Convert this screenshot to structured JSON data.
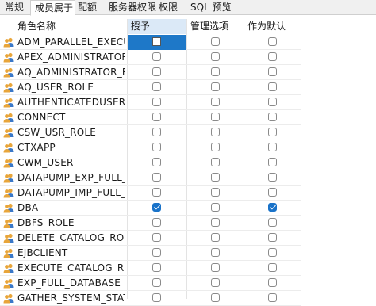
{
  "tabs": [
    {
      "label": "常规",
      "active": false
    },
    {
      "label": "成员属于",
      "active": true
    },
    {
      "label": "配额",
      "active": false
    },
    {
      "label": "服务器权限",
      "active": false
    },
    {
      "label": "权限",
      "active": false
    },
    {
      "label": "SQL 预览",
      "active": false
    }
  ],
  "columns": {
    "name": "角色名称",
    "grant": "授予",
    "admin": "管理选项",
    "default": "作为默认"
  },
  "rows": [
    {
      "name": "ADM_PARALLEL_EXECUTE",
      "grant": false,
      "admin": false,
      "default": false
    },
    {
      "name": "APEX_ADMINISTRATOR_ROLE",
      "grant": false,
      "admin": false,
      "default": false
    },
    {
      "name": "AQ_ADMINISTRATOR_ROLE",
      "grant": false,
      "admin": false,
      "default": false
    },
    {
      "name": "AQ_USER_ROLE",
      "grant": false,
      "admin": false,
      "default": false
    },
    {
      "name": "AUTHENTICATEDUSER",
      "grant": false,
      "admin": false,
      "default": false
    },
    {
      "name": "CONNECT",
      "grant": false,
      "admin": false,
      "default": false
    },
    {
      "name": "CSW_USR_ROLE",
      "grant": false,
      "admin": false,
      "default": false
    },
    {
      "name": "CTXAPP",
      "grant": false,
      "admin": false,
      "default": false
    },
    {
      "name": "CWM_USER",
      "grant": false,
      "admin": false,
      "default": false
    },
    {
      "name": "DATAPUMP_EXP_FULL_DATABASE",
      "grant": false,
      "admin": false,
      "default": false
    },
    {
      "name": "DATAPUMP_IMP_FULL_DATABASE",
      "grant": false,
      "admin": false,
      "default": false
    },
    {
      "name": "DBA",
      "grant": true,
      "admin": false,
      "default": true
    },
    {
      "name": "DBFS_ROLE",
      "grant": false,
      "admin": false,
      "default": false
    },
    {
      "name": "DELETE_CATALOG_ROLE",
      "grant": false,
      "admin": false,
      "default": false
    },
    {
      "name": "EJBCLIENT",
      "grant": false,
      "admin": false,
      "default": false
    },
    {
      "name": "EXECUTE_CATALOG_ROLE",
      "grant": false,
      "admin": false,
      "default": false
    },
    {
      "name": "EXP_FULL_DATABASE",
      "grant": false,
      "admin": false,
      "default": false
    },
    {
      "name": "GATHER_SYSTEM_STATISTICS",
      "grant": false,
      "admin": false,
      "default": false
    }
  ],
  "colors": {
    "selected_cell": "#1e78c8",
    "checkbox_checked": "#1a73c9",
    "header_selected": "#dbe9f7",
    "role_icon_head": "#e8a53a",
    "role_icon_body": "#3a78c8"
  },
  "icons": {
    "tab_bar": "none",
    "row": "users-icon"
  }
}
